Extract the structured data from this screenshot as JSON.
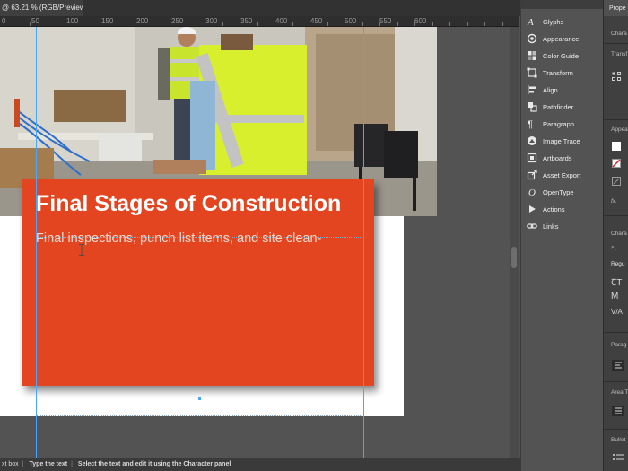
{
  "document_tab": {
    "title": "@ 63.21 % (RGB/Preview)"
  },
  "ruler": {
    "labels": [
      "0",
      "50",
      "100",
      "150",
      "200",
      "250",
      "300",
      "350",
      "400",
      "450",
      "500",
      "550",
      "600"
    ]
  },
  "slide": {
    "headline": "Final Stages of Construction",
    "subline": "Final inspections, punch list items, and site clean-",
    "accent_color": "#e2451f"
  },
  "status_bar": {
    "item1": "xt box",
    "item2": "Type the text",
    "item3_prefix": "Select the text and edit it using the",
    "item3_link": "Character panel"
  },
  "panels": [
    {
      "label": "Glyphs",
      "icon": "glyphs-icon"
    },
    {
      "label": "Appearance",
      "icon": "appearance-icon"
    },
    {
      "label": "Color Guide",
      "icon": "color-guide-icon"
    },
    {
      "label": "Transform",
      "icon": "transform-icon"
    },
    {
      "label": "Align",
      "icon": "align-icon"
    },
    {
      "label": "Pathfinder",
      "icon": "pathfinder-icon"
    },
    {
      "label": "Paragraph",
      "icon": "paragraph-icon"
    },
    {
      "label": "Image Trace",
      "icon": "image-trace-icon"
    },
    {
      "label": "Artboards",
      "icon": "artboards-icon"
    },
    {
      "label": "Asset Export",
      "icon": "asset-export-icon"
    },
    {
      "label": "OpenType",
      "icon": "opentype-icon"
    },
    {
      "label": "Actions",
      "icon": "actions-icon"
    },
    {
      "label": "Links",
      "icon": "links-icon"
    }
  ],
  "properties_panel": {
    "tab": "Prope",
    "section_character": "Chara",
    "transform": "Transf",
    "appearance": "Appea",
    "character": "Chara",
    "font_style": "Regu",
    "paragraph": "Parag",
    "area_type": "Area T",
    "bullets": "Bullet"
  }
}
